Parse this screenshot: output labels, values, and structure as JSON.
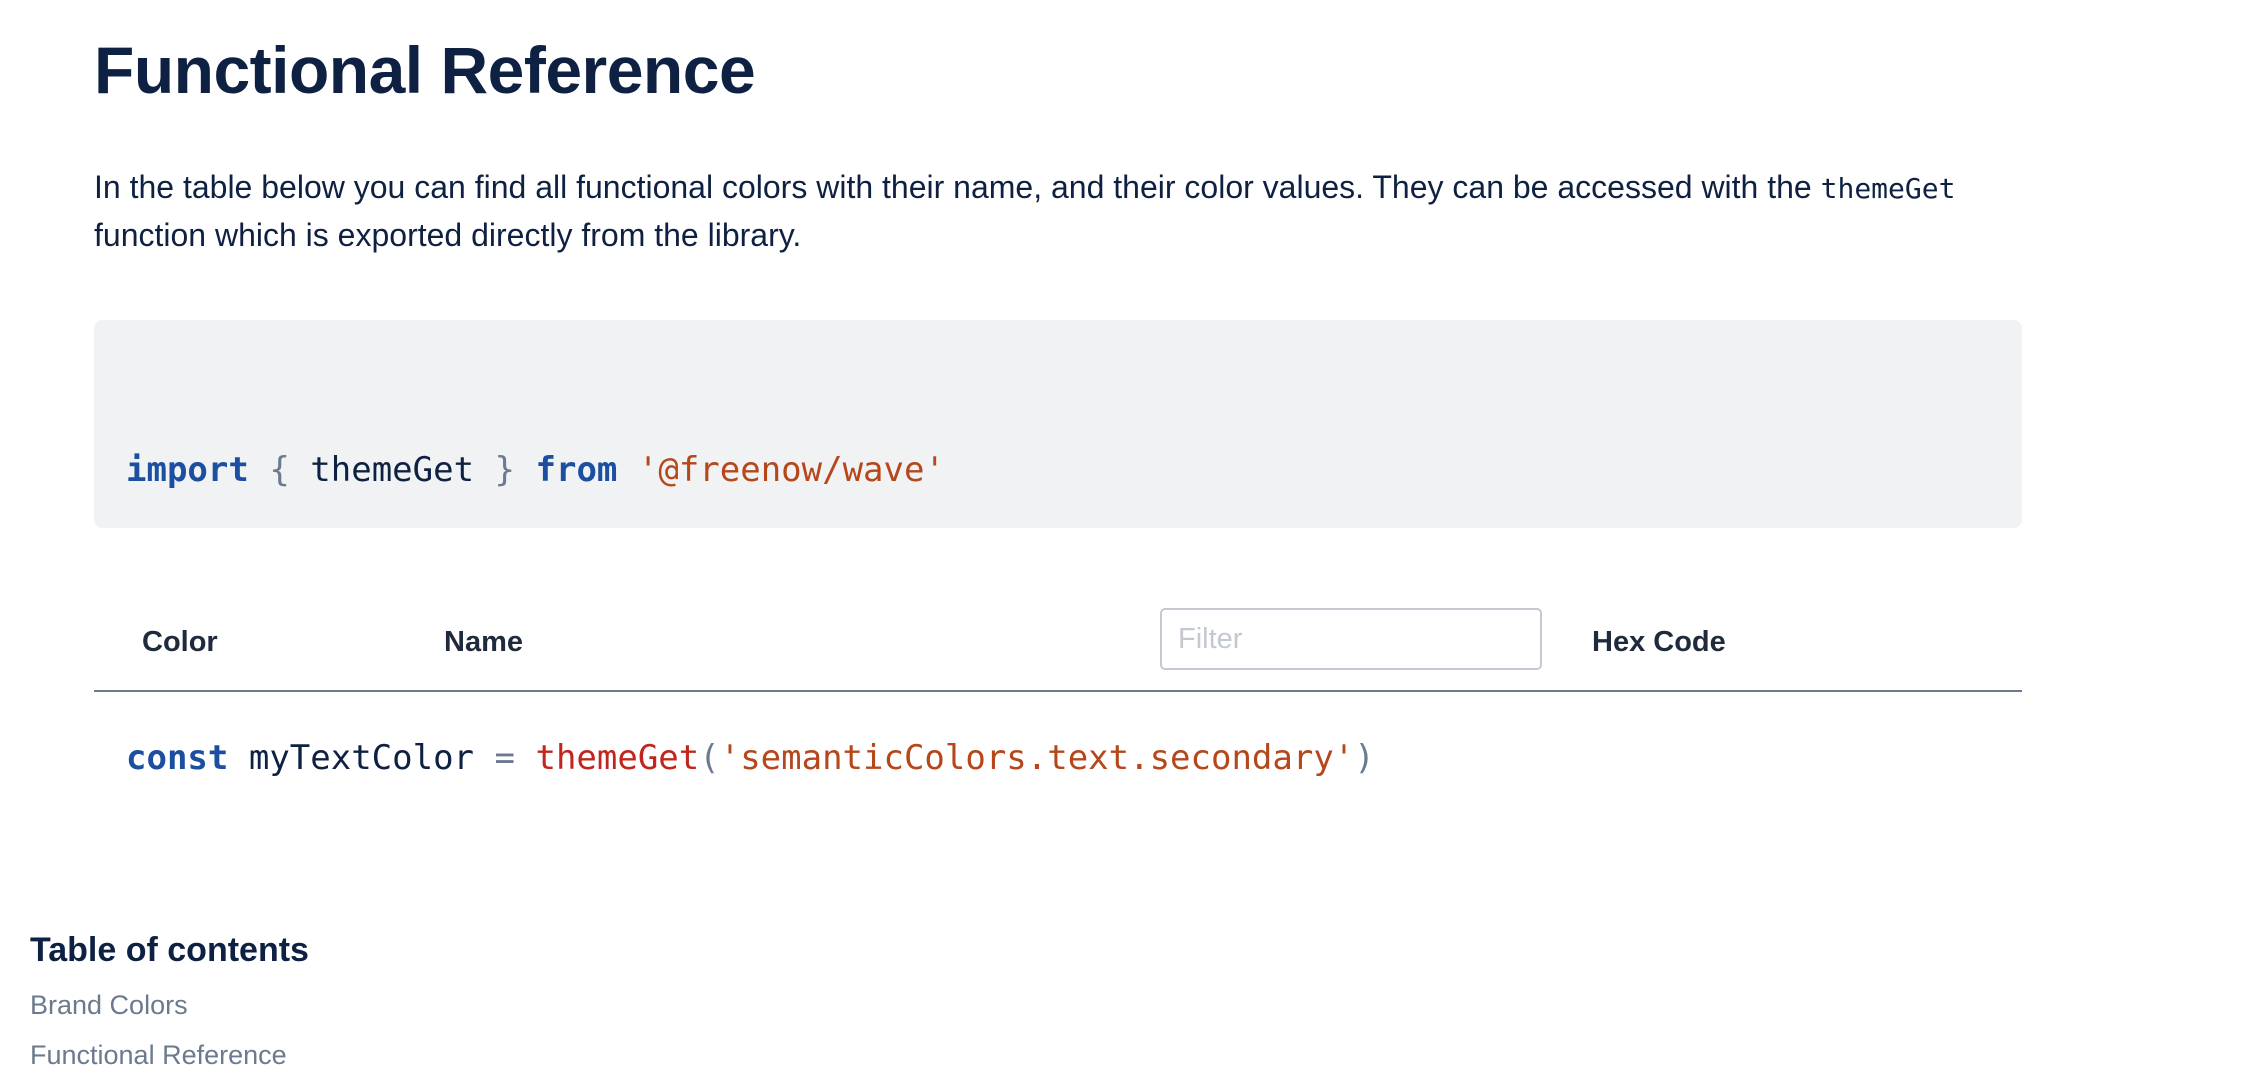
{
  "page": {
    "title": "Functional Reference",
    "intro_before": "In the table below you can find all functional colors with their name, and their color values. They can be accessed with the ",
    "intro_code": "themeGet",
    "intro_after": " function which is exported directly from the library."
  },
  "code": {
    "line1": {
      "kw_import": "import",
      "brace_open": "{",
      "ident": "themeGet",
      "brace_close": "}",
      "kw_from": "from",
      "module": "'@freenow/wave'"
    },
    "line2": {
      "kw_const": "const",
      "var": "myTextColor",
      "equals": "=",
      "fn": "themeGet",
      "paren_open": "(",
      "arg": "'semanticColors.text.secondary'",
      "paren_close": ")"
    }
  },
  "table": {
    "headers": {
      "color": "Color",
      "name": "Name",
      "hex": "Hex Code"
    },
    "filter": {
      "placeholder": "Filter",
      "value": ""
    },
    "rows": []
  },
  "toc": {
    "title": "Table of contents",
    "items": [
      {
        "label": "Brand Colors"
      },
      {
        "label": "Functional Reference"
      }
    ]
  },
  "colors": {
    "text_primary": "#0f2142",
    "keyword": "#1c4fa0",
    "string": "#b5471b",
    "function": "#c0261d",
    "muted": "#6b7a8f",
    "code_bg": "#f1f2f4"
  }
}
